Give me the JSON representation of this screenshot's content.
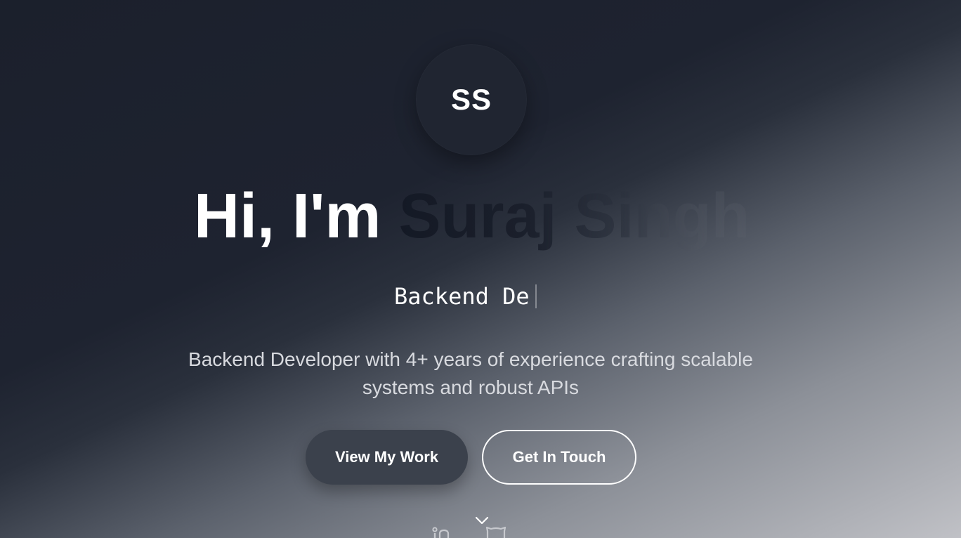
{
  "avatar": {
    "initials": "SS"
  },
  "headline": {
    "greeting": "Hi, I'm",
    "name": "Suraj Singh"
  },
  "role": {
    "typed_text": "Backend De"
  },
  "description": "Backend Developer with 4+ years of experience crafting scalable systems and robust APIs",
  "buttons": {
    "primary_label": "View My Work",
    "secondary_label": "Get In Touch"
  },
  "icons": {
    "scroll": "chevron-down-icon",
    "social": [
      "linkedin-icon",
      "github-icon"
    ]
  },
  "colors": {
    "text": "#ffffff",
    "description": "#d8dadf",
    "primary_button": "#3b414c",
    "background_dark": "#1b202c",
    "background_light": "#c0c1c6"
  }
}
